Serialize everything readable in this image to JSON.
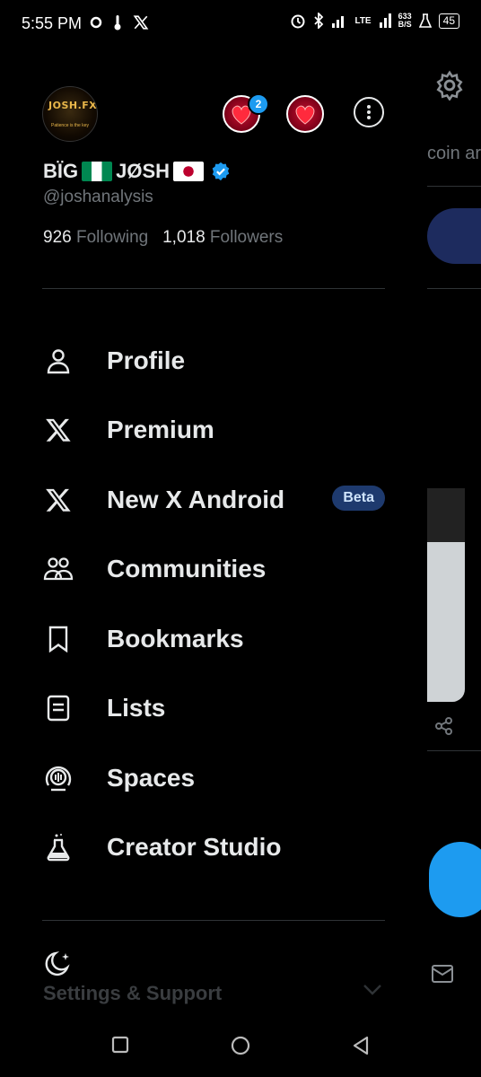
{
  "status_bar": {
    "time": "5:55 PM",
    "net_speed_value": "633",
    "net_speed_unit": "B/S",
    "network": "LTE",
    "battery": "45"
  },
  "profile": {
    "avatar_text": "JOSH.FX",
    "avatar_subtext": "Patience is the key",
    "display_name_part1": "BÏG",
    "display_name_part2": "JØSH",
    "handle": "@joshanalysis",
    "following_count": "926",
    "following_label": "Following",
    "followers_count": "1,018",
    "followers_label": "Followers",
    "account_switch_badge": "2"
  },
  "menu": [
    {
      "label": "Profile",
      "icon": "person-icon"
    },
    {
      "label": "Premium",
      "icon": "x-logo-icon"
    },
    {
      "label": "New X Android",
      "icon": "x-logo-icon",
      "badge": "Beta"
    },
    {
      "label": "Communities",
      "icon": "communities-icon"
    },
    {
      "label": "Bookmarks",
      "icon": "bookmark-icon"
    },
    {
      "label": "Lists",
      "icon": "list-icon"
    },
    {
      "label": "Spaces",
      "icon": "spaces-icon"
    },
    {
      "label": "Creator Studio",
      "icon": "flask-icon"
    }
  ],
  "footer": {
    "settings_support": "Settings & Support"
  },
  "background_feed": {
    "partial_text": "coin ar"
  },
  "colors": {
    "background": "#000000",
    "text_primary": "#e7e9ea",
    "text_secondary": "#71767b",
    "accent": "#1d9bf0",
    "beta_badge_bg": "#1e3a6e"
  }
}
